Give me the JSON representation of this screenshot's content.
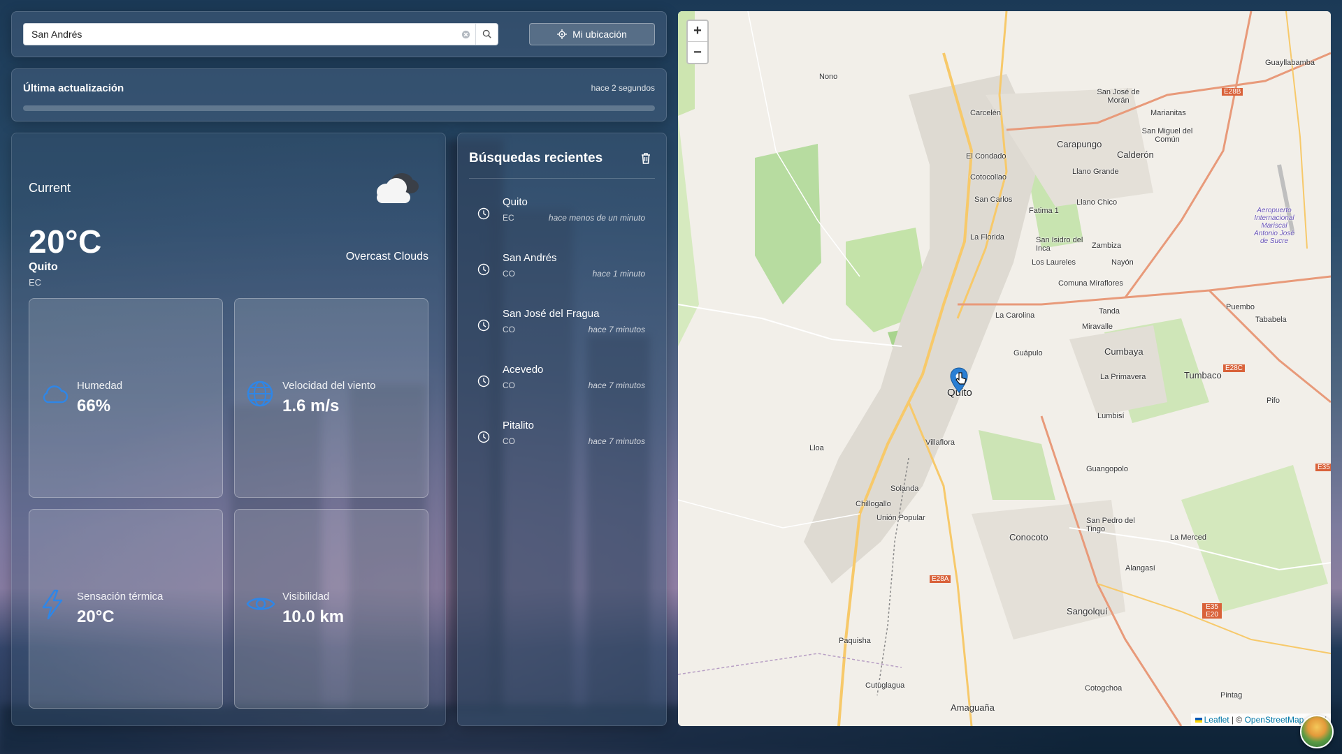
{
  "search": {
    "value": "San Andrés",
    "location_button": "Mi ubicación"
  },
  "update": {
    "title": "Última actualización",
    "time": "hace 2 segundos",
    "progress": 0.0
  },
  "weather": {
    "section": "Current",
    "temperature": "20°C",
    "city": "Quito",
    "country": "EC",
    "description": "Overcast Clouds",
    "icon": "cloud-icon",
    "tiles": [
      {
        "label": "Humedad",
        "value": "66%",
        "icon": "cloud-outline-icon"
      },
      {
        "label": "Velocidad del viento",
        "value": "1.6 m/s",
        "icon": "globe-icon"
      },
      {
        "label": "Sensación térmica",
        "value": "20°C",
        "icon": "lightning-icon"
      },
      {
        "label": "Visibilidad",
        "value": "10.0 km",
        "icon": "eye-icon"
      }
    ]
  },
  "recent": {
    "title": "Búsquedas recientes",
    "items": [
      {
        "name": "Quito",
        "country": "EC",
        "time": "hace menos de un minuto"
      },
      {
        "name": "San Andrés",
        "country": "CO",
        "time": "hace 1 minuto"
      },
      {
        "name": "San José del Fragua",
        "country": "CO",
        "time": "hace 7 minutos"
      },
      {
        "name": "Acevedo",
        "country": "CO",
        "time": "hace 7 minutos"
      },
      {
        "name": "Pitalito",
        "country": "CO",
        "time": "hace 7 minutos"
      }
    ]
  },
  "map": {
    "zoom_in": "+",
    "zoom_out": "−",
    "attribution": {
      "leaflet": "Leaflet",
      "sep": " | © ",
      "osm": "OpenStreetMap",
      "rest": " contri"
    },
    "labels": {
      "quito": "Quito",
      "nono": "Nono",
      "carcelen": "Carcelén",
      "carapungo": "Carapungo",
      "calderon": "Calderón",
      "el_condado": "El Condado",
      "cotocollao": "Cotocollao",
      "san_carlos": "San Carlos",
      "fatima": "Fatima 1",
      "la_florida": "La Florida",
      "san_isidro": "San Isidro del Inca",
      "los_laureles": "Los Laureles",
      "llano_grande": "Llano Grande",
      "llano_chico": "Llano Chico",
      "zambiza": "Zambiza",
      "nayon": "Nayón",
      "comuna_miraflores": "Comuna Miraflores",
      "la_carolina": "La Carolina",
      "tanda": "Tanda",
      "miravalle": "Miravalle",
      "guapulo": "Guápulo",
      "cumbaya": "Cumbaya",
      "tumbaco": "Tumbaco",
      "la_primavera": "La Primavera",
      "lumbisi": "Lumbisí",
      "villaflora": "Villaflora",
      "lloa": "Lloa",
      "guangopolo": "Guangopolo",
      "solanda": "Solanda",
      "chillogallo": "Chillogallo",
      "union_popular": "Unión Popular",
      "conocoto": "Conocoto",
      "san_pedro": "San Pedro del Tingo",
      "la_merced": "La Merced",
      "alangasi": "Alangasí",
      "sangolqui": "Sangolquí",
      "paquisha": "Paquisha",
      "cutuglagua": "Cutuglagua",
      "amaguana": "Amaguaña",
      "cotogchoa": "Cotogchoa",
      "pintag": "Pintag",
      "puembo": "Puembo",
      "tababela": "Tababela",
      "pifo": "Pifo",
      "guayllabamba": "Guayllabamba",
      "san_jose_moran": "San José de Morán",
      "marianitas": "Marianitas",
      "san_miguel": "San Miguel del Común",
      "aeropuerto": "Aeropuerto Internacional Mariscal Antonio José de Sucre",
      "e28b": "E28B",
      "e28c": "E28C",
      "e28a": "E28A",
      "e35": "E35",
      "e35e20": "E35 E20"
    }
  }
}
